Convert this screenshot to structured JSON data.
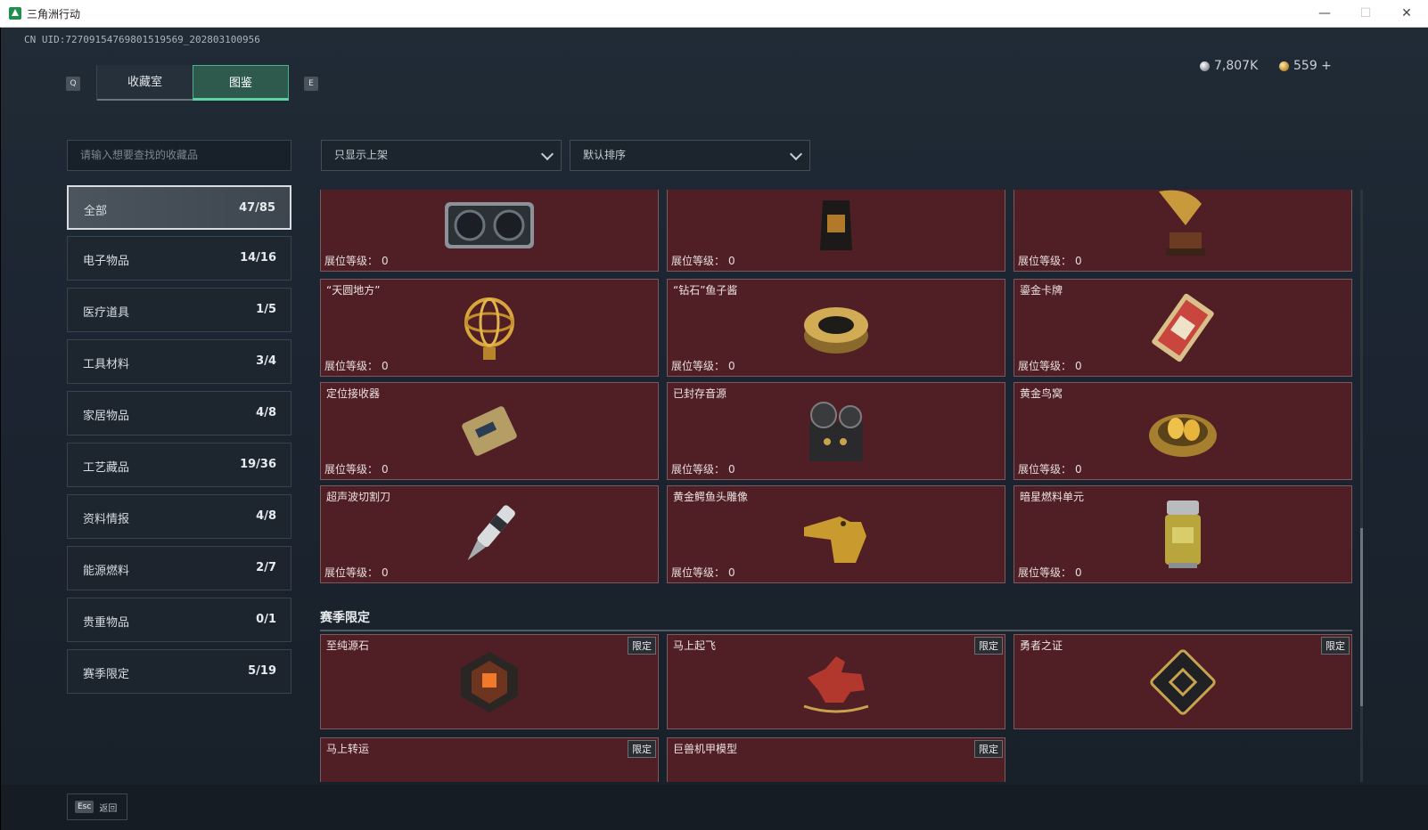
{
  "window": {
    "title": "三角洲行动",
    "minimize": "—",
    "maximize": "☐",
    "close": "✕"
  },
  "header": {
    "uid": "CN UID:7270915476980151956​9_202803100956",
    "key_q": "Q",
    "key_e": "E",
    "tabs": [
      {
        "label": "收藏室"
      },
      {
        "label": "图鉴"
      }
    ],
    "currency": {
      "silver": "7,807K",
      "gold": "559 +"
    }
  },
  "sidebar": {
    "search_placeholder": "请输入想要查找的收藏品",
    "categories": [
      {
        "name": "全部",
        "count": "47/85"
      },
      {
        "name": "电子物品",
        "count": "14/16"
      },
      {
        "name": "医疗道具",
        "count": "1/5"
      },
      {
        "name": "工具材料",
        "count": "3/4"
      },
      {
        "name": "家居物品",
        "count": "4/8"
      },
      {
        "name": "工艺藏品",
        "count": "19/36"
      },
      {
        "name": "资料情报",
        "count": "4/8"
      },
      {
        "name": "能源燃料",
        "count": "2/7"
      },
      {
        "name": "贵重物品",
        "count": "0/1"
      },
      {
        "name": "赛季限定",
        "count": "5/19"
      }
    ]
  },
  "filters": {
    "display": "只显示上架",
    "sort": "默认排序"
  },
  "level_label": "展位等级：",
  "cards": [
    {
      "name": "",
      "level": "0",
      "icon": "gpu-icon"
    },
    {
      "name": "",
      "level": "0",
      "icon": "coffee-bag-icon"
    },
    {
      "name": "",
      "level": "0",
      "icon": "gramophone-icon"
    },
    {
      "name": "“天圆地方”",
      "level": "0",
      "icon": "armillary-sphere-icon"
    },
    {
      "name": "“钻石”鱼子酱",
      "level": "0",
      "icon": "caviar-tin-icon"
    },
    {
      "name": "鎏金卡牌",
      "level": "0",
      "icon": "gilded-card-icon"
    },
    {
      "name": "定位接收器",
      "level": "0",
      "icon": "receiver-icon"
    },
    {
      "name": "已封存音源",
      "level": "0",
      "icon": "tape-recorder-icon"
    },
    {
      "name": "黄金鸟窝",
      "level": "0",
      "icon": "golden-nest-icon"
    },
    {
      "name": "超声波切割刀",
      "level": "0",
      "icon": "cutter-icon"
    },
    {
      "name": "黄金鳄鱼头雕像",
      "level": "0",
      "icon": "croc-statue-icon"
    },
    {
      "name": "暗星燃料单元",
      "level": "0",
      "icon": "fuel-cell-icon"
    }
  ],
  "season_section": {
    "title": "赛季限定",
    "tag": "限定",
    "cards": [
      {
        "name": "至纯源石",
        "icon": "source-stone-icon"
      },
      {
        "name": "马上起飞",
        "icon": "rocking-horse-icon"
      },
      {
        "name": "勇者之证",
        "icon": "badge-card-icon"
      },
      {
        "name": "马上转运",
        "icon": "item-icon"
      },
      {
        "name": "巨兽机甲模型",
        "icon": "item-icon"
      }
    ]
  },
  "footer": {
    "esc": "Esc",
    "back": "返回"
  }
}
